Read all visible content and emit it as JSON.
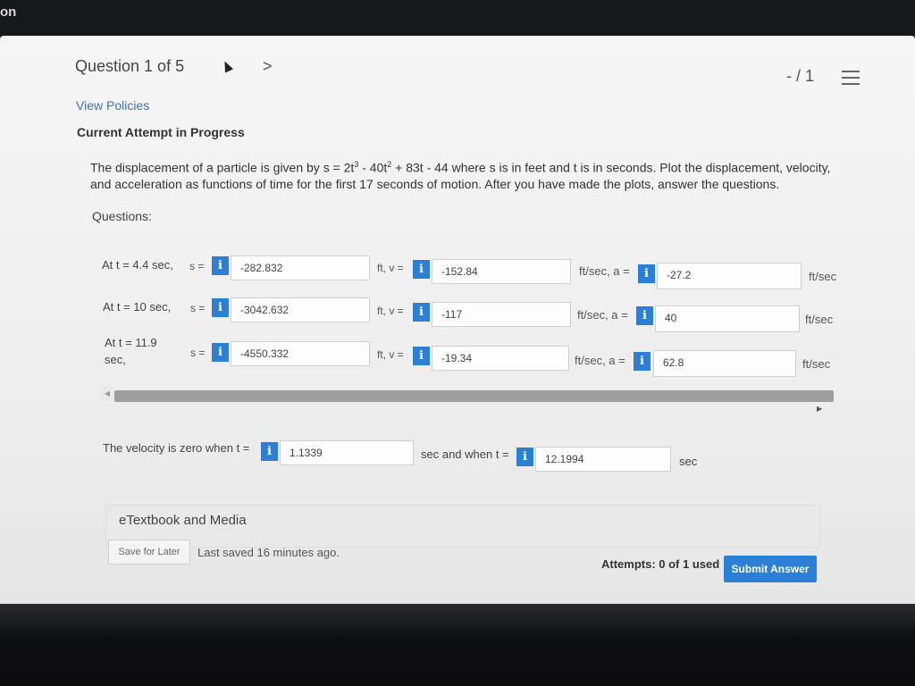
{
  "os_bar": {
    "partial_text": "on"
  },
  "header": {
    "question_label": "Question 1 of 5",
    "next_glyph": ">",
    "score": "- / 1"
  },
  "view_policies": "View Policies",
  "attempt_status": "Current Attempt in Progress",
  "problem": {
    "line1_pre": "The displacement of a particle is given by s = 2t",
    "exp3": "3",
    "line1_mid": " - 40t",
    "exp2": "2",
    "line1_post": " + 83t - 44 where s is in feet and t is in seconds. Plot the displacement, velocity,",
    "line2": "and acceleration as functions of time for the first 17 seconds of motion. After you have made the plots, answer the questions."
  },
  "questions_label": "Questions:",
  "info_glyph": "i",
  "rows": [
    {
      "label": "At t = 4.4 sec,",
      "s_eq": "s =",
      "s_value": "-282.832",
      "v_eq": "ft, v =",
      "v_value": "-152.84",
      "a_eq": "ft/sec, a =",
      "a_value": "-27.2",
      "unit": "ft/sec"
    },
    {
      "label": "At t = 10 sec,",
      "s_eq": "s =",
      "s_value": "-3042.632",
      "v_eq": "ft, v =",
      "v_value": "-117",
      "a_eq": "ft/sec, a =",
      "a_value": "40",
      "unit": "ft/sec"
    },
    {
      "label_line1": "At t = 11.9",
      "label_line2": "sec,",
      "s_eq": "s =",
      "s_value": "-4550.332",
      "v_eq": "ft, v =",
      "v_value": "-19.34",
      "a_eq": "ft/sec, a =",
      "a_value": "62.8",
      "unit": "ft/sec"
    }
  ],
  "velocity_zero": {
    "prefix": "The velocity is zero when t =",
    "t1": "1.1339",
    "middle": "sec and when t =",
    "t2": "12.1994",
    "suffix": "sec"
  },
  "etextbook": "eTextbook and Media",
  "footer": {
    "save_label": "Save for Later",
    "last_saved": "Last saved 16 minutes ago.",
    "attempts": "Attempts: 0 of 1 used",
    "submit_label": "Submit Answer"
  },
  "colors": {
    "accent": "#2b7fd4",
    "link": "#3a73b8"
  }
}
